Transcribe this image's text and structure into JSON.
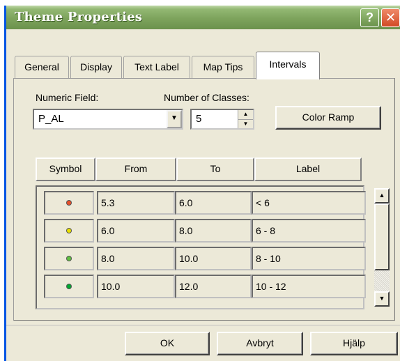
{
  "window": {
    "title": "Theme Properties",
    "help_label": "?",
    "close_label": "✕"
  },
  "tabs": [
    {
      "label": "General"
    },
    {
      "label": "Display"
    },
    {
      "label": "Text Label"
    },
    {
      "label": "Map Tips"
    },
    {
      "label": "Intervals",
      "active": true
    }
  ],
  "numeric_field": {
    "label": "Numeric Field:",
    "value": "P_AL"
  },
  "classes": {
    "label": "Number of Classes:",
    "value": "5"
  },
  "color_ramp_label": "Color Ramp",
  "table": {
    "headers": [
      "Symbol",
      "From",
      "To",
      "Label"
    ],
    "rows": [
      {
        "symbol_color": "#e8502a",
        "from": "5.3",
        "to": "6.0",
        "label": "< 6"
      },
      {
        "symbol_color": "#e8e000",
        "from": "6.0",
        "to": "8.0",
        "label": "6 - 8"
      },
      {
        "symbol_color": "#60c040",
        "from": "8.0",
        "to": "10.0",
        "label": "8 - 10"
      },
      {
        "symbol_color": "#00a830",
        "from": "10.0",
        "to": "12.0",
        "label": "10 - 12"
      }
    ]
  },
  "buttons": {
    "ok": "OK",
    "cancel": "Avbryt",
    "help": "Hjälp"
  }
}
